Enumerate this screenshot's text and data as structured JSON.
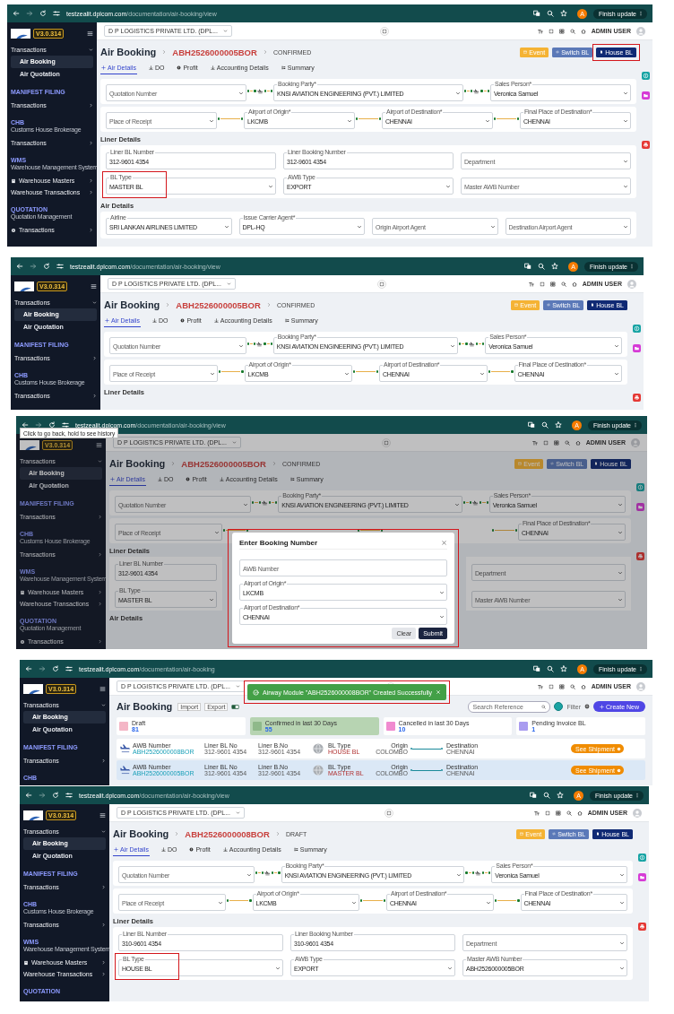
{
  "screenshots": [
    {
      "kind": "booking_view",
      "browser": {
        "host": "testzealit.dplcom.com",
        "path": "/documentation/air-booking/view",
        "profile_initial": "A",
        "update_button": "Finish update"
      },
      "sidebar": {
        "version": "V3.0.314",
        "items": [
          {
            "kind": "group",
            "label": "Transactions",
            "expanded": true
          },
          {
            "kind": "link",
            "label": "Air Booking",
            "selected": true
          },
          {
            "kind": "link",
            "label": "Air Quotation",
            "selected": false
          },
          {
            "kind": "section",
            "label": "MANIFEST FILING"
          },
          {
            "kind": "group",
            "label": "Transactions",
            "expanded": false
          },
          {
            "kind": "section",
            "label": "CHB",
            "subtitle": "Customs House Brokerage"
          },
          {
            "kind": "group",
            "label": "Transactions",
            "expanded": false
          },
          {
            "kind": "section",
            "label": "WMS",
            "subtitle": "Warehouse Management System"
          },
          {
            "kind": "group",
            "label": "Warehouse Masters",
            "expanded": false,
            "has_icon": true
          },
          {
            "kind": "group",
            "label": "Warehouse Transactions",
            "expanded": false
          },
          {
            "kind": "section",
            "label": "QUOTATION",
            "subtitle": "Quotation Management"
          },
          {
            "kind": "group",
            "label": "Transactions",
            "expanded": false,
            "has_icon": true
          }
        ]
      },
      "header": {
        "company": "D P LOGISTICS PRIVATE LTD. (DPL...",
        "user": "ADMIN USER"
      },
      "page": {
        "title": "Air Booking",
        "booking_number": "ABH2526000005BOR",
        "status": "CONFIRMED",
        "actions": [
          {
            "kind": "event",
            "label": "Event",
            "highlighted": false
          },
          {
            "kind": "switch",
            "label": "Switch BL",
            "highlighted": false
          },
          {
            "kind": "house",
            "label": "House BL",
            "highlighted": true
          }
        ],
        "tabs": [
          {
            "kind": "plus",
            "label": "Air Details",
            "selected": true
          },
          {
            "kind": "anchor",
            "label": "DO",
            "selected": false
          },
          {
            "kind": "coin",
            "label": "Profit",
            "selected": false
          },
          {
            "kind": "anchor",
            "label": "Accounting Details",
            "selected": false
          },
          {
            "kind": "tree",
            "label": "Summary",
            "selected": false
          }
        ],
        "route": {
          "quotation": {
            "kind": "select",
            "placeholder": "Quotation Number"
          },
          "booking_party": {
            "kind": "select",
            "label": "Booking Party*",
            "value": "KNSI AVIATION ENGINEERING (PVT.) LIMITED"
          },
          "sales_person": {
            "kind": "select",
            "label": "Sales Person*",
            "value": "Veronica Samuel"
          }
        },
        "ports": {
          "place_of_receipt": {
            "kind": "select",
            "placeholder": "Place of Receipt"
          },
          "origin": {
            "kind": "select",
            "label": "Airport of Origin*",
            "value": "LKCMB"
          },
          "destination": {
            "kind": "select",
            "label": "Airport of Destination*",
            "value": "CHENNAI"
          },
          "final_destination": {
            "kind": "select",
            "label": "Final Place of Destination*",
            "value": "CHENNAI"
          }
        },
        "liner": {
          "heading": "Liner Details",
          "fields": {
            "liner_bl_number": {
              "kind": "text",
              "label": "Liner BL Number",
              "value": "312-9601 4354"
            },
            "liner_booking_number": {
              "kind": "text",
              "label": "Liner Booking Number",
              "value": "312-9601 4354"
            },
            "department": {
              "kind": "select",
              "placeholder": "Department"
            },
            "bl_type": {
              "kind": "select",
              "label": "BL Type",
              "value": "MASTER BL",
              "highlighted": true
            },
            "awb_type": {
              "kind": "select",
              "label": "AWB Type",
              "value": "EXPORT"
            },
            "master_awb_number": {
              "kind": "select",
              "placeholder": "Master AWB Number"
            }
          }
        },
        "air": {
          "heading": "Air Details",
          "fields": {
            "airline": {
              "kind": "select",
              "label": "Airline",
              "value": "SRI LANKAN AIRLINES LIMITED"
            },
            "issue_carrier_agent": {
              "kind": "select",
              "label": "Issue Carrier Agent*",
              "value": "DPL-HQ"
            },
            "origin_airport_agent": {
              "kind": "select",
              "placeholder": "Origin Airport Agent"
            },
            "destination_airport_agent": {
              "kind": "select",
              "placeholder": "Destination Airport Agent"
            }
          }
        }
      },
      "side_buttons": [
        {
          "kind": "currency"
        },
        {
          "kind": "folder"
        },
        {
          "kind": "print"
        }
      ]
    },
    {
      "kind": "booking_view",
      "browser": {
        "host": "testzealit.dplcom.com",
        "path": "/documentation/air-booking/view",
        "profile_initial": "A",
        "update_button": "Finish update"
      },
      "sidebar": {
        "version": "V3.0.314",
        "items": [
          {
            "kind": "group",
            "label": "Transactions",
            "expanded": true
          },
          {
            "kind": "link",
            "label": "Air Booking",
            "selected": true
          },
          {
            "kind": "link",
            "label": "Air Quotation",
            "selected": false
          },
          {
            "kind": "section",
            "label": "MANIFEST FILING"
          },
          {
            "kind": "group",
            "label": "Transactions",
            "expanded": false
          },
          {
            "kind": "section",
            "label": "CHB",
            "subtitle": "Customs House Brokerage"
          },
          {
            "kind": "group",
            "label": "Transactions",
            "expanded": false
          }
        ]
      },
      "header": {
        "company": "D P LOGISTICS PRIVATE LTD. (DPL...",
        "user": "ADMIN USER"
      },
      "page": {
        "title": "Air Booking",
        "booking_number": "ABH2526000005BOR",
        "status": "CONFIRMED",
        "actions": [
          {
            "kind": "event",
            "label": "Event",
            "highlighted": false
          },
          {
            "kind": "switch",
            "label": "Switch BL",
            "highlighted": false
          },
          {
            "kind": "house",
            "label": "House BL",
            "highlighted": false
          }
        ],
        "tabs": [
          {
            "kind": "plus",
            "label": "Air Details",
            "selected": true
          },
          {
            "kind": "anchor",
            "label": "DO",
            "selected": false
          },
          {
            "kind": "coin",
            "label": "Profit",
            "selected": false
          },
          {
            "kind": "anchor",
            "label": "Accounting Details",
            "selected": false
          },
          {
            "kind": "tree",
            "label": "Summary",
            "selected": false
          }
        ],
        "route": {
          "quotation": {
            "kind": "select",
            "placeholder": "Quotation Number"
          },
          "booking_party": {
            "kind": "select",
            "label": "Booking Party*",
            "value": "KNSI AVIATION ENGINEERING (PVT.) LIMITED"
          },
          "sales_person": {
            "kind": "select",
            "label": "Sales Person*",
            "value": "Veronica Samuel"
          }
        },
        "ports": {
          "place_of_receipt": {
            "kind": "select",
            "placeholder": "Place of Receipt"
          },
          "origin": {
            "kind": "select",
            "label": "Airport of Origin*",
            "value": "LKCMB"
          },
          "destination": {
            "kind": "select",
            "label": "Airport of Destination*",
            "value": "CHENNAI"
          },
          "final_destination": {
            "kind": "select",
            "label": "Final Place of Destination*",
            "value": "CHENNAI"
          }
        },
        "liner": {
          "heading": "Liner Details"
        }
      },
      "side_buttons": [
        {
          "kind": "currency"
        },
        {
          "kind": "folder"
        },
        {
          "kind": "print"
        }
      ]
    },
    {
      "kind": "booking_view",
      "browser": {
        "host": "testzealit.dplcom.com",
        "path": "/documentation/air-booking/view",
        "profile_initial": "A",
        "update_button": "Finish update",
        "tooltip": "Click to go back, hold to see history"
      },
      "sidebar": {
        "version": "V3.0.314",
        "items": [
          {
            "kind": "group",
            "label": "Transactions",
            "expanded": true
          },
          {
            "kind": "link",
            "label": "Air Booking",
            "selected": true
          },
          {
            "kind": "link",
            "label": "Air Quotation",
            "selected": false
          },
          {
            "kind": "section",
            "label": "MANIFEST FILING"
          },
          {
            "kind": "group",
            "label": "Transactions",
            "expanded": false
          },
          {
            "kind": "section",
            "label": "CHB",
            "subtitle": "Customs House Brokerage"
          },
          {
            "kind": "group",
            "label": "Transactions",
            "expanded": false
          },
          {
            "kind": "section",
            "label": "WMS",
            "subtitle": "Warehouse Management System"
          },
          {
            "kind": "group",
            "label": "Warehouse Masters",
            "expanded": false,
            "has_icon": true
          },
          {
            "kind": "group",
            "label": "Warehouse Transactions",
            "expanded": false
          },
          {
            "kind": "section",
            "label": "QUOTATION",
            "subtitle": "Quotation Management"
          },
          {
            "kind": "group",
            "label": "Transactions",
            "expanded": false,
            "has_icon": true
          }
        ]
      },
      "header": {
        "company": "D P LOGISTICS PRIVATE LTD. (DPL...",
        "user": "ADMIN USER"
      },
      "page": {
        "title": "Air Booking",
        "booking_number": "ABH2526000005BOR",
        "status": "CONFIRMED",
        "actions": [
          {
            "kind": "event",
            "label": "Event",
            "highlighted": false
          },
          {
            "kind": "switch",
            "label": "Switch BL",
            "highlighted": false
          },
          {
            "kind": "house",
            "label": "House BL",
            "highlighted": false
          }
        ],
        "tabs": [
          {
            "kind": "plus",
            "label": "Air Details",
            "selected": true
          },
          {
            "kind": "anchor",
            "label": "DO",
            "selected": false
          },
          {
            "kind": "coin",
            "label": "Profit",
            "selected": false
          },
          {
            "kind": "anchor",
            "label": "Accounting Details",
            "selected": false
          },
          {
            "kind": "tree",
            "label": "Summary",
            "selected": false
          }
        ],
        "route": {
          "quotation": {
            "kind": "select",
            "placeholder": "Quotation Number"
          },
          "booking_party": {
            "kind": "select",
            "label": "Booking Party*",
            "value": "KNSI AVIATION ENGINEERING (PVT.) LIMITED"
          },
          "sales_person": {
            "kind": "select",
            "label": "Sales Person*",
            "value": "Veronica Samuel"
          }
        },
        "ports": {
          "place_of_receipt": {
            "kind": "select",
            "placeholder": "Place of Receipt"
          },
          "final_destination": {
            "kind": "select",
            "label": "Final Place of Destination*",
            "value": "CHENNAI"
          }
        },
        "liner": {
          "heading": "Liner Details",
          "fields": {
            "liner_bl_number": {
              "kind": "text",
              "label": "Liner BL Number",
              "value": "312-9601 4354"
            },
            "department": {
              "kind": "select",
              "placeholder": "Department"
            },
            "bl_type": {
              "kind": "select",
              "label": "BL Type",
              "value": "MASTER BL"
            },
            "master_awb_number": {
              "kind": "select",
              "placeholder": "Master AWB Number"
            }
          }
        },
        "air": {
          "heading": "Air Details"
        }
      },
      "side_buttons": [
        {
          "kind": "currency"
        },
        {
          "kind": "folder"
        },
        {
          "kind": "print"
        }
      ],
      "modal": {
        "title": "Enter Booking Number",
        "highlighted": true,
        "fields": [
          {
            "kind": "text",
            "placeholder": "AWB Number"
          },
          {
            "kind": "select",
            "label": "Airport of Origin*",
            "value": "LKCMB"
          },
          {
            "kind": "select",
            "label": "Airport of Destination*",
            "value": "CHENNAI"
          }
        ],
        "buttons": [
          {
            "kind": "secondary",
            "label": "Clear"
          },
          {
            "kind": "primary",
            "label": "Submit"
          }
        ]
      }
    },
    {
      "kind": "booking_list",
      "browser": {
        "host": "testzealit.dplcom.com",
        "path": "/documentation/air-booking",
        "profile_initial": "A",
        "update_button": "Finish update"
      },
      "sidebar": {
        "version": "V3.0.314",
        "items": [
          {
            "kind": "group",
            "label": "Transactions",
            "expanded": true
          },
          {
            "kind": "link",
            "label": "Air Booking",
            "selected": true
          },
          {
            "kind": "link",
            "label": "Air Quotation",
            "selected": false
          },
          {
            "kind": "section",
            "label": "MANIFEST FILING"
          },
          {
            "kind": "group",
            "label": "Transactions",
            "expanded": false
          },
          {
            "kind": "section",
            "label": "CHB"
          }
        ]
      },
      "header": {
        "company": "D P LOGISTICS PRIVATE LTD. (DPL...",
        "user": "ADMIN USER"
      },
      "toast": {
        "message": "Airway Module \"ABH2526000008BOR\" Created Successfully",
        "highlighted": true
      },
      "list": {
        "title": "Air Booking",
        "mode_labels": [
          "Import",
          "Export"
        ],
        "mode_on": true,
        "search": {
          "placeholder": "Search Reference"
        },
        "filter": "Filter",
        "create_button": "Create New",
        "stats": [
          {
            "label": "Draft",
            "count": "81",
            "color": "#f4b6c6",
            "selected": false
          },
          {
            "label": "Confirmed in last 30 Days",
            "count": "55",
            "color": "#8fb98a",
            "selected": true
          },
          {
            "label": "Cancelled in last 30 Days",
            "count": "10",
            "color": "#f08ad0",
            "selected": false
          },
          {
            "label": "Pending Invoice BL",
            "count": "1",
            "color": "#a99cf0",
            "selected": false
          }
        ],
        "rows": [
          {
            "awb_label": "AWB Number",
            "awb": "ABH2526000008BOR",
            "liner_bl_label": "Liner BL No",
            "liner_bl": "312-9601 4354",
            "liner_b_label": "Liner B.No",
            "liner_b": "312-9601 4354",
            "bl_type_label": "BL Type",
            "bl_type": "HOUSE BL",
            "origin_label": "Origin",
            "origin": "COLOMBO",
            "destination_label": "Destination",
            "destination": "CHENNAI",
            "action": "See Shipment",
            "selected": false
          },
          {
            "awb_label": "AWB Number",
            "awb": "ABH2526000005BOR",
            "liner_bl_label": "Liner BL No",
            "liner_bl": "312-9601 4354",
            "liner_b_label": "Liner B.No",
            "liner_b": "312-9601 4354",
            "bl_type_label": "BL Type",
            "bl_type": "MASTER BL",
            "origin_label": "Origin",
            "origin": "COLOMBO",
            "destination_label": "Destination",
            "destination": "CHENNAI",
            "action": "See Shipment",
            "selected": true
          }
        ]
      }
    },
    {
      "kind": "booking_view",
      "browser": {
        "host": "testzealit.dplcom.com",
        "path": "/documentation/air-booking/view",
        "profile_initial": "A",
        "update_button": "Finish update"
      },
      "sidebar": {
        "version": "V3.0.314",
        "items": [
          {
            "kind": "group",
            "label": "Transactions",
            "expanded": true
          },
          {
            "kind": "link",
            "label": "Air Booking",
            "selected": true
          },
          {
            "kind": "link",
            "label": "Air Quotation",
            "selected": false
          },
          {
            "kind": "section",
            "label": "MANIFEST FILING"
          },
          {
            "kind": "group",
            "label": "Transactions",
            "expanded": false
          },
          {
            "kind": "section",
            "label": "CHB",
            "subtitle": "Customs House Brokerage"
          },
          {
            "kind": "group",
            "label": "Transactions",
            "expanded": false
          },
          {
            "kind": "section",
            "label": "WMS",
            "subtitle": "Warehouse Management System"
          },
          {
            "kind": "group",
            "label": "Warehouse Masters",
            "expanded": false,
            "has_icon": true
          },
          {
            "kind": "group",
            "label": "Warehouse Transactions",
            "expanded": false
          },
          {
            "kind": "section",
            "label": "QUOTATION"
          }
        ]
      },
      "header": {
        "company": "D P LOGISTICS PRIVATE LTD. (DPL...",
        "user": "ADMIN USER"
      },
      "page": {
        "title": "Air Booking",
        "booking_number": "ABH2526000008BOR",
        "status": "DRAFT",
        "actions": [
          {
            "kind": "event",
            "label": "Event",
            "highlighted": false
          },
          {
            "kind": "switch",
            "label": "Switch BL",
            "highlighted": false
          },
          {
            "kind": "house",
            "label": "House BL",
            "highlighted": false
          }
        ],
        "tabs": [
          {
            "kind": "plus",
            "label": "Air Details",
            "selected": true
          },
          {
            "kind": "anchor",
            "label": "DO",
            "selected": false
          },
          {
            "kind": "coin",
            "label": "Profit",
            "selected": false
          },
          {
            "kind": "anchor",
            "label": "Accounting Details",
            "selected": false
          },
          {
            "kind": "tree",
            "label": "Summary",
            "selected": false
          }
        ],
        "route": {
          "quotation": {
            "kind": "select",
            "placeholder": "Quotation Number"
          },
          "booking_party": {
            "kind": "select",
            "label": "Booking Party*",
            "value": "KNSI AVIATION ENGINEERING (PVT.) LIMITED"
          },
          "sales_person": {
            "kind": "select",
            "label": "Sales Person*",
            "value": "Veronica Samuel"
          }
        },
        "ports": {
          "place_of_receipt": {
            "kind": "select",
            "placeholder": "Place of Receipt"
          },
          "origin": {
            "kind": "select",
            "label": "Airport of Origin*",
            "value": "LKCMB"
          },
          "destination": {
            "kind": "select",
            "label": "Airport of Destination*",
            "value": "CHENNAI"
          },
          "final_destination": {
            "kind": "select",
            "label": "Final Place of Destination*",
            "value": "CHENNAI"
          }
        },
        "liner": {
          "heading": "Liner Details",
          "fields": {
            "liner_bl_number": {
              "kind": "text",
              "label": "Liner BL Number",
              "value": "310-9601 4354"
            },
            "liner_booking_number": {
              "kind": "text",
              "label": "Liner Booking Number",
              "value": "310-9601 4354"
            },
            "department": {
              "kind": "select",
              "placeholder": "Department"
            },
            "bl_type": {
              "kind": "select",
              "label": "BL Type",
              "value": "HOUSE BL",
              "highlighted": true
            },
            "awb_type": {
              "kind": "select",
              "label": "AWB Type",
              "value": "EXPORT"
            },
            "master_awb_number": {
              "kind": "select",
              "label": "Master AWB Number",
              "value": "ABH2526000005BOR"
            }
          }
        }
      },
      "side_buttons": [
        {
          "kind": "currency"
        },
        {
          "kind": "folder"
        },
        {
          "kind": "print"
        }
      ]
    }
  ]
}
